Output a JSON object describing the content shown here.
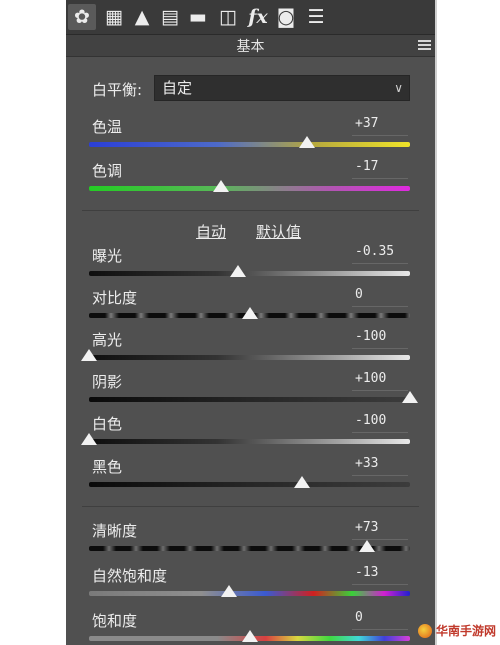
{
  "toolbar": {
    "tools": [
      {
        "name": "basic-tab-icon",
        "glyph": "✿"
      },
      {
        "name": "tone-curve-icon",
        "glyph": "▦"
      },
      {
        "name": "detail-icon",
        "glyph": "▲"
      },
      {
        "name": "hsl-icon",
        "glyph": "▤"
      },
      {
        "name": "split-toning-icon",
        "glyph": "▬"
      },
      {
        "name": "lens-corrections-icon",
        "glyph": "◫"
      },
      {
        "name": "effects-icon",
        "glyph": "fx"
      },
      {
        "name": "camera-calibration-icon",
        "glyph": "◙"
      },
      {
        "name": "presets-icon",
        "glyph": "☰"
      }
    ]
  },
  "panel": {
    "title": "基本",
    "white_balance": {
      "label": "白平衡:",
      "value": "自定"
    },
    "auto_label": "自动",
    "default_label": "默认值"
  },
  "sliders": [
    {
      "label": "色温",
      "value": "+37",
      "position": 0.68
    },
    {
      "label": "色调",
      "value": "-17",
      "position": 0.41
    },
    {
      "label": "曝光",
      "value": "-0.35",
      "position": 0.465
    },
    {
      "label": "对比度",
      "value": "0",
      "position": 0.5
    },
    {
      "label": "高光",
      "value": "-100",
      "position": 0.0
    },
    {
      "label": "阴影",
      "value": "+100",
      "position": 1.0
    },
    {
      "label": "白色",
      "value": "-100",
      "position": 0.0
    },
    {
      "label": "黑色",
      "value": "+33",
      "position": 0.665
    },
    {
      "label": "清晰度",
      "value": "+73",
      "position": 0.865
    },
    {
      "label": "自然饱和度",
      "value": "-13",
      "position": 0.435
    },
    {
      "label": "饱和度",
      "value": "0",
      "position": 0.5
    }
  ],
  "colors": {
    "panel_bg": "#505050",
    "toolbar_bg": "#3a3a3a",
    "text": "#ececec"
  },
  "watermark": "华南手游网"
}
